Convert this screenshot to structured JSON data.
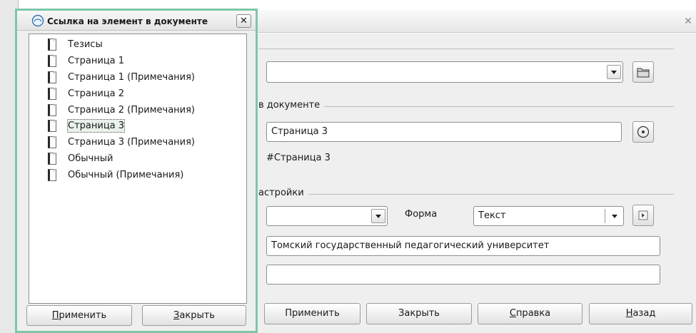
{
  "navigator": {
    "title": "Ссылка на элемент в документе",
    "close_label": "✕",
    "items": [
      {
        "label": "Тезисы"
      },
      {
        "label": "Страница 1"
      },
      {
        "label": "Страница 1 (Примечания)"
      },
      {
        "label": "Страница 2"
      },
      {
        "label": "Страница 2 (Примечания)"
      },
      {
        "label": "Страница 3",
        "selected": true
      },
      {
        "label": "Страница 3 (Примечания)"
      },
      {
        "label": "Обычный"
      },
      {
        "label": "Обычный (Примечания)"
      }
    ],
    "apply_button": {
      "underline": "П",
      "rest": "рименить"
    },
    "close_button": {
      "underline": "З",
      "rest": "акрыть"
    }
  },
  "dialog": {
    "close_label": "✕",
    "target_section_label": "в документе",
    "target_value": "Страница 3",
    "url_preview": "#Страница 3",
    "settings_section_label": "астройки",
    "form_label": "Форма",
    "form_value": "Текст",
    "text_value": "Томский государственный педагогический университет",
    "name_value": "",
    "buttons": {
      "apply": "Применить",
      "close": "Закрыть",
      "help": {
        "underline": "С",
        "rest": "правка"
      },
      "back": {
        "underline": "Н",
        "rest": "азад"
      }
    }
  }
}
